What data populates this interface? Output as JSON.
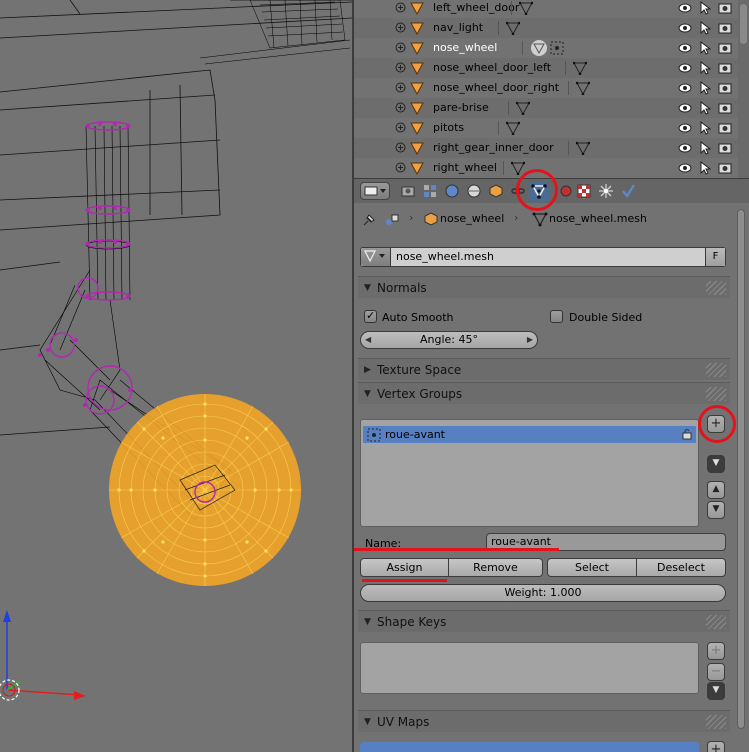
{
  "outliner": {
    "rows": [
      {
        "name": "left_wheel_door"
      },
      {
        "name": "nav_light"
      },
      {
        "name": "nose_wheel"
      },
      {
        "name": "nose_wheel_door_left"
      },
      {
        "name": "nose_wheel_door_right"
      },
      {
        "name": "pare-brise"
      },
      {
        "name": "pitots"
      },
      {
        "name": "right_gear_inner_door"
      },
      {
        "name": "right_wheel"
      }
    ],
    "active_row": "nose_wheel"
  },
  "properties": {
    "tabs": [
      "render-tab",
      "render-layers-tab",
      "scene-tab",
      "world-tab",
      "object-tab",
      "constraints-tab",
      "modifiers-tab",
      "data-tab",
      "material-tab",
      "texture-tab",
      "particles-tab",
      "physics-tab"
    ],
    "active_tab": "data-tab",
    "breadcrumb": {
      "object": "nose_wheel",
      "mesh": "nose_wheel.mesh"
    },
    "datablock": {
      "name": "nose_wheel.mesh",
      "fake_user": "F"
    },
    "normals": {
      "title": "Normals",
      "auto_smooth_label": "Auto Smooth",
      "auto_smooth": true,
      "double_sided_label": "Double Sided",
      "double_sided": false,
      "angle": "Angle: 45°"
    },
    "texture_space": {
      "title": "Texture Space"
    },
    "vertex_groups": {
      "title": "Vertex Groups",
      "items": [
        {
          "name": "roue-avant"
        }
      ],
      "name_label": "Name:",
      "name_value": "roue-avant",
      "assign_label": "Assign",
      "remove_label": "Remove",
      "select_label": "Select",
      "deselect_label": "Deselect",
      "weight": "Weight: 1.000"
    },
    "shape_keys": {
      "title": "Shape Keys"
    },
    "uv_maps": {
      "title": "UV Maps"
    }
  },
  "colors": {
    "selection_blue": "#5680c2",
    "annotation_red": "#e3121c",
    "selected_vertices": "#f5a623",
    "mesh_purple": "#b02ab0"
  }
}
